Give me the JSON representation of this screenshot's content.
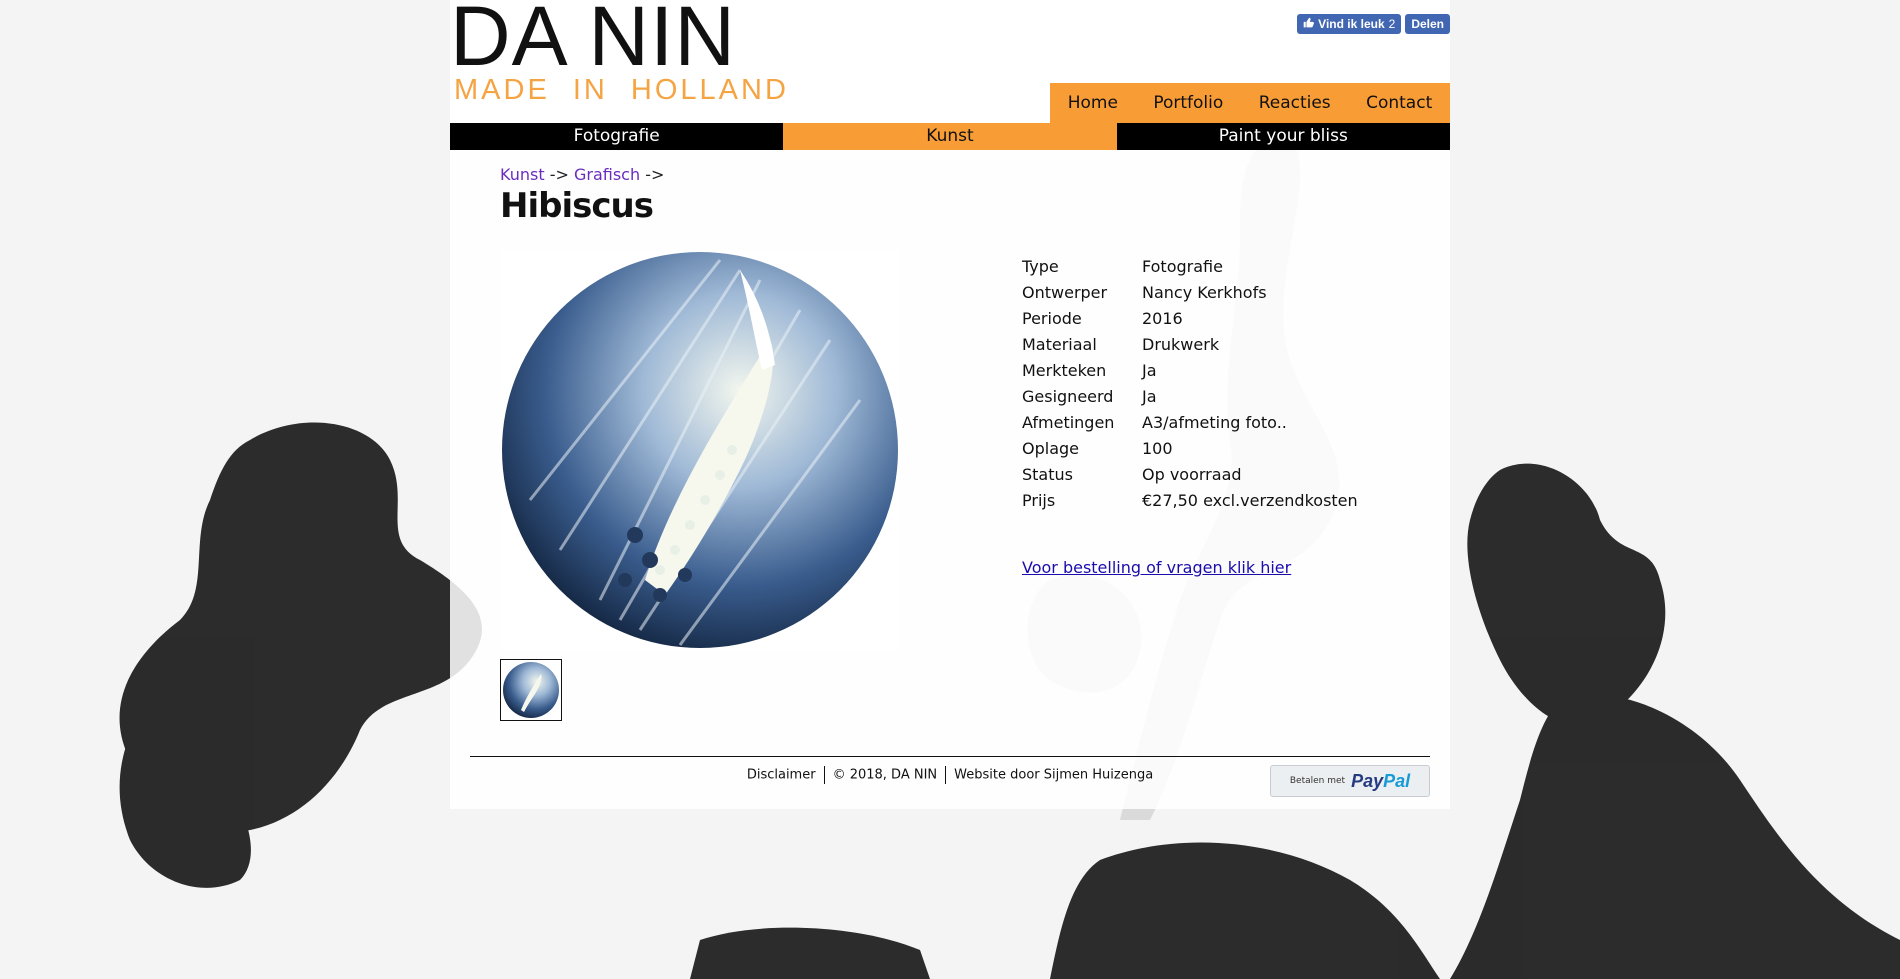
{
  "logo": {
    "title": "DA NIN",
    "subtitle": "MADE IN HOLLAND"
  },
  "facebook": {
    "like_label": "Vind ik leuk",
    "like_count": "2",
    "share_label": "Delen"
  },
  "main_nav": [
    {
      "label": "Home"
    },
    {
      "label": "Portfolio"
    },
    {
      "label": "Reacties"
    },
    {
      "label": "Contact"
    }
  ],
  "categories": [
    {
      "label": "Fotografie",
      "active": false
    },
    {
      "label": "Kunst",
      "active": true
    },
    {
      "label": "Paint your bliss",
      "active": false
    }
  ],
  "breadcrumb": {
    "item1": "Kunst",
    "sep1": "->",
    "item2": "Grafisch",
    "sep2": "->"
  },
  "product": {
    "title": "Hibiscus",
    "specs": [
      {
        "key": "Type",
        "value": "Fotografie"
      },
      {
        "key": "Ontwerper",
        "value": "Nancy Kerkhofs"
      },
      {
        "key": "Periode",
        "value": "2016"
      },
      {
        "key": "Materiaal",
        "value": "Drukwerk"
      },
      {
        "key": "Merkteken",
        "value": "Ja"
      },
      {
        "key": "Gesigneerd",
        "value": "Ja"
      },
      {
        "key": "Afmetingen",
        "value": "A3/afmeting foto.."
      },
      {
        "key": "Oplage",
        "value": "100"
      },
      {
        "key": "Status",
        "value": "Op voorraad"
      },
      {
        "key": "Prijs",
        "value": "€27,50 excl.verzendkosten"
      }
    ],
    "order_link": "Voor bestelling of vragen klik hier"
  },
  "footer": {
    "disclaimer": "Disclaimer",
    "copyright": "© 2018, DA NIN",
    "credit": "Website door Sijmen Huizenga"
  },
  "paypal": {
    "small_label": "Betalen met",
    "logo_pay": "Pay",
    "logo_pal": "Pal"
  },
  "colors": {
    "accent": "#f89c36",
    "logo_subtitle": "#f5a443",
    "link": "#1a0dab",
    "crumb": "#6a2cbf",
    "facebook": "#4267b2"
  }
}
